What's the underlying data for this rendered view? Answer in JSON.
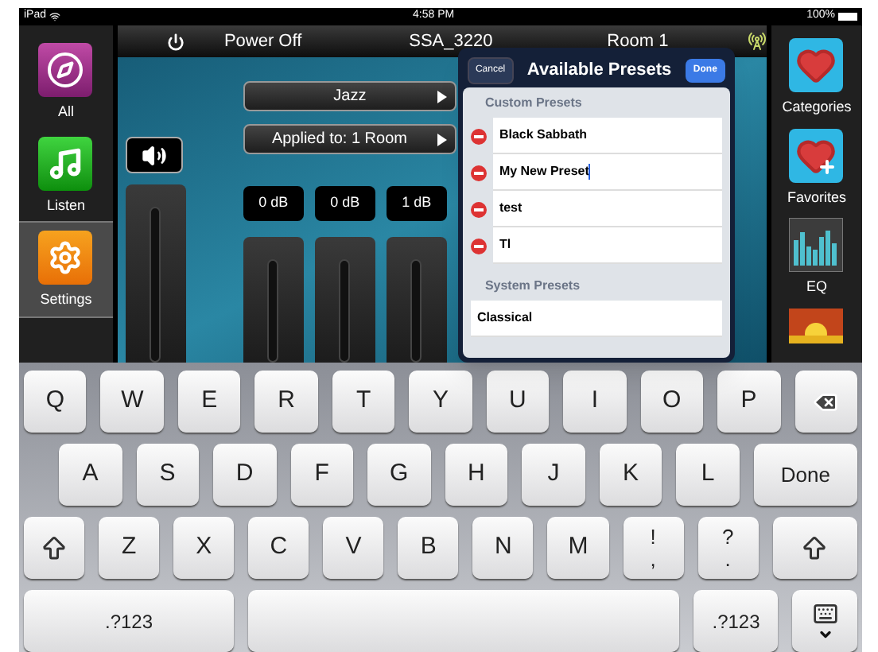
{
  "status_bar": {
    "device": "iPad",
    "time": "4:58 PM",
    "battery": "100%"
  },
  "top_bar": {
    "power_label": "Power Off",
    "zone": "SSA_3220",
    "room": "Room 1"
  },
  "left_nav": [
    {
      "label": "All",
      "kind": "all",
      "selected": false
    },
    {
      "label": "Listen",
      "kind": "listen",
      "selected": false
    },
    {
      "label": "Settings",
      "kind": "settings",
      "selected": true
    }
  ],
  "right_nav": [
    {
      "label": "Categories",
      "kind": "categories"
    },
    {
      "label": "Favorites",
      "kind": "favorites"
    },
    {
      "label": "EQ",
      "kind": "eq"
    },
    {
      "kind": "sunset"
    }
  ],
  "eq_panel": {
    "preset": "Jazz",
    "applied_to": "Applied to: 1 Room",
    "channels": [
      {
        "reading": "0 dB"
      },
      {
        "reading": "0 dB"
      },
      {
        "reading": "1 dB"
      }
    ]
  },
  "popover": {
    "cancel": "Cancel",
    "title": "Available Presets",
    "done": "Done",
    "sections": [
      {
        "heading": "Custom Presets",
        "items": [
          {
            "label": "Black Sabbath",
            "deletable": true,
            "editing": false
          },
          {
            "label": "My New Preset",
            "deletable": true,
            "editing": true
          },
          {
            "label": "test",
            "deletable": true,
            "editing": false
          },
          {
            "label": "Tl",
            "deletable": true,
            "editing": false
          }
        ]
      },
      {
        "heading": "System Presets",
        "items": [
          {
            "label": "Classical",
            "deletable": false,
            "editing": false
          }
        ]
      }
    ]
  },
  "keyboard": {
    "top_row": [
      {
        "kind": "char",
        "label": "Q"
      },
      {
        "kind": "char",
        "label": "W"
      },
      {
        "kind": "char",
        "label": "E"
      },
      {
        "kind": "char",
        "label": "R"
      },
      {
        "kind": "char",
        "label": "T"
      },
      {
        "kind": "char",
        "label": "Y"
      },
      {
        "kind": "char",
        "label": "U"
      },
      {
        "kind": "char",
        "label": "I"
      },
      {
        "kind": "char",
        "label": "O"
      },
      {
        "kind": "char",
        "label": "P"
      },
      {
        "kind": "backspace"
      }
    ],
    "home_row": [
      {
        "kind": "char",
        "label": "A"
      },
      {
        "kind": "char",
        "label": "S"
      },
      {
        "kind": "char",
        "label": "D"
      },
      {
        "kind": "char",
        "label": "F"
      },
      {
        "kind": "char",
        "label": "G"
      },
      {
        "kind": "char",
        "label": "H"
      },
      {
        "kind": "char",
        "label": "J"
      },
      {
        "kind": "char",
        "label": "K"
      },
      {
        "kind": "char",
        "label": "L"
      },
      {
        "kind": "done",
        "label": "Done"
      }
    ],
    "bottom_row": [
      {
        "kind": "shift"
      },
      {
        "kind": "char",
        "label": "Z"
      },
      {
        "kind": "char",
        "label": "X"
      },
      {
        "kind": "char",
        "label": "C"
      },
      {
        "kind": "char",
        "label": "V"
      },
      {
        "kind": "char",
        "label": "B"
      },
      {
        "kind": "char",
        "label": "N"
      },
      {
        "kind": "char",
        "label": "M"
      },
      {
        "kind": "dual",
        "label": "!",
        "secondary": ","
      },
      {
        "kind": "dual",
        "label": "?",
        "secondary": "."
      },
      {
        "kind": "shift"
      }
    ],
    "space_row": [
      {
        "kind": "numbers",
        "label": ".?123"
      },
      {
        "kind": "space"
      },
      {
        "kind": "numbers",
        "label": ".?123"
      },
      {
        "kind": "hide"
      }
    ]
  }
}
